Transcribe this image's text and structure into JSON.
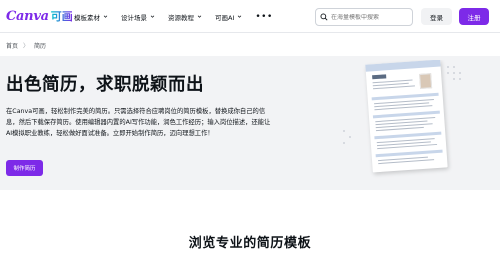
{
  "brand": {
    "logo_text": "Canva",
    "logo_cn": "可画",
    "accent": "#7d2ae8"
  },
  "nav": {
    "items": [
      {
        "label": "模板素材"
      },
      {
        "label": "设计场景"
      },
      {
        "label": "资源教程"
      },
      {
        "label": "可画AI"
      }
    ],
    "more": "•••"
  },
  "search": {
    "placeholder": "在海量模板中搜索"
  },
  "auth": {
    "login": "登录",
    "signup": "注册"
  },
  "breadcrumb": {
    "home": "首页",
    "sep": "〉",
    "current": "简历"
  },
  "hero": {
    "title": "出色简历，求职脱颖而出",
    "description": "在Canva可画，轻松制作完美的简历。只需选择符合应聘岗位的简历模板，替换成你自己的信息，然后下载保存简历。使用编辑器内置的AI写作功能，润色工作经历；输入岗位描述，还能让AI模拟职业教练，轻松做好面试准备。立即开始制作简历，迈向理想工作！",
    "button": "制作简历",
    "background": "#f2f3f5"
  },
  "section": {
    "title": "浏览专业的简历模板"
  }
}
